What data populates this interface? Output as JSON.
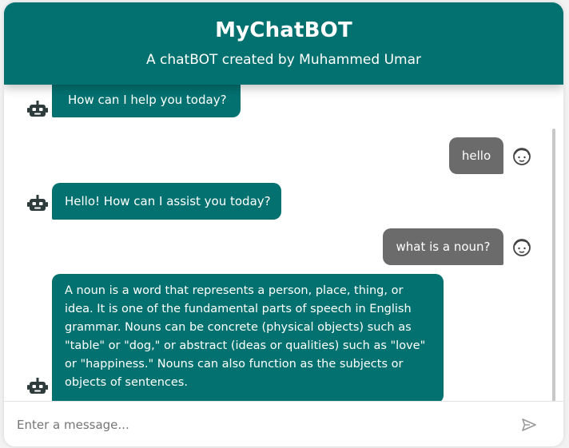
{
  "header": {
    "title": "MyChatBOT",
    "subtitle": "A chatBOT created by Muhammed Umar"
  },
  "messages": [
    {
      "role": "bot",
      "text": "How can I help you today?",
      "avatar": "robot-icon"
    },
    {
      "role": "user",
      "text": "hello",
      "avatar": "face-icon"
    },
    {
      "role": "bot",
      "text": "Hello! How can I assist you today?",
      "avatar": "robot-icon"
    },
    {
      "role": "user",
      "text": "what is a noun?",
      "avatar": "face-icon"
    },
    {
      "role": "bot",
      "text": "A noun is a word that represents a person, place, thing, or idea. It is one of the fundamental parts of speech in English grammar. Nouns can be concrete (physical objects) such as \"table\" or \"dog,\" or abstract (ideas or qualities) such as \"love\" or \"happiness.\" Nouns can also function as the subjects or objects of sentences.",
      "avatar": "robot-icon"
    }
  ],
  "input": {
    "placeholder": "Enter a message...",
    "value": ""
  },
  "icons": {
    "send": "send-icon"
  },
  "colors": {
    "brand": "#037170",
    "user_bubble": "#6b6b6b",
    "background": "#ffffff"
  }
}
